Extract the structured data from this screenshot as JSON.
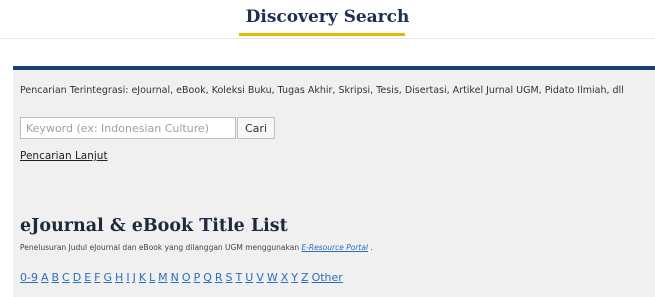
{
  "header": {
    "title": "Discovery Search"
  },
  "search": {
    "description": "Pencarian Terintegrasi: eJournal, eBook, Koleksi Buku, Tugas Akhir, Skripsi, Tesis, Disertasi, Artikel Jurnal UGM, Pidato Ilmiah, dll",
    "placeholder": "Keyword (ex: Indonesian Culture)",
    "value": "",
    "button_label": "Cari",
    "advanced_label": "Pencarian Lanjut"
  },
  "title_list": {
    "heading": "eJournal & eBook Title List",
    "description_prefix": "Penelusuran Judul eJournal dan eBook yang dilanggan UGM menggunakan ",
    "portal_link": "E-Resource Portal",
    "description_suffix": " .",
    "letters": [
      "0-9",
      "A",
      "B",
      "C",
      "D",
      "E",
      "F",
      "G",
      "H",
      "I",
      "J",
      "K",
      "L",
      "M",
      "N",
      "O",
      "P",
      "Q",
      "R",
      "S",
      "T",
      "U",
      "V",
      "W",
      "X",
      "Y",
      "Z",
      "Other"
    ]
  },
  "colors": {
    "accent_bar": "#1c3f73",
    "title_underline": "#e6b800",
    "link": "#2a6fbf"
  }
}
